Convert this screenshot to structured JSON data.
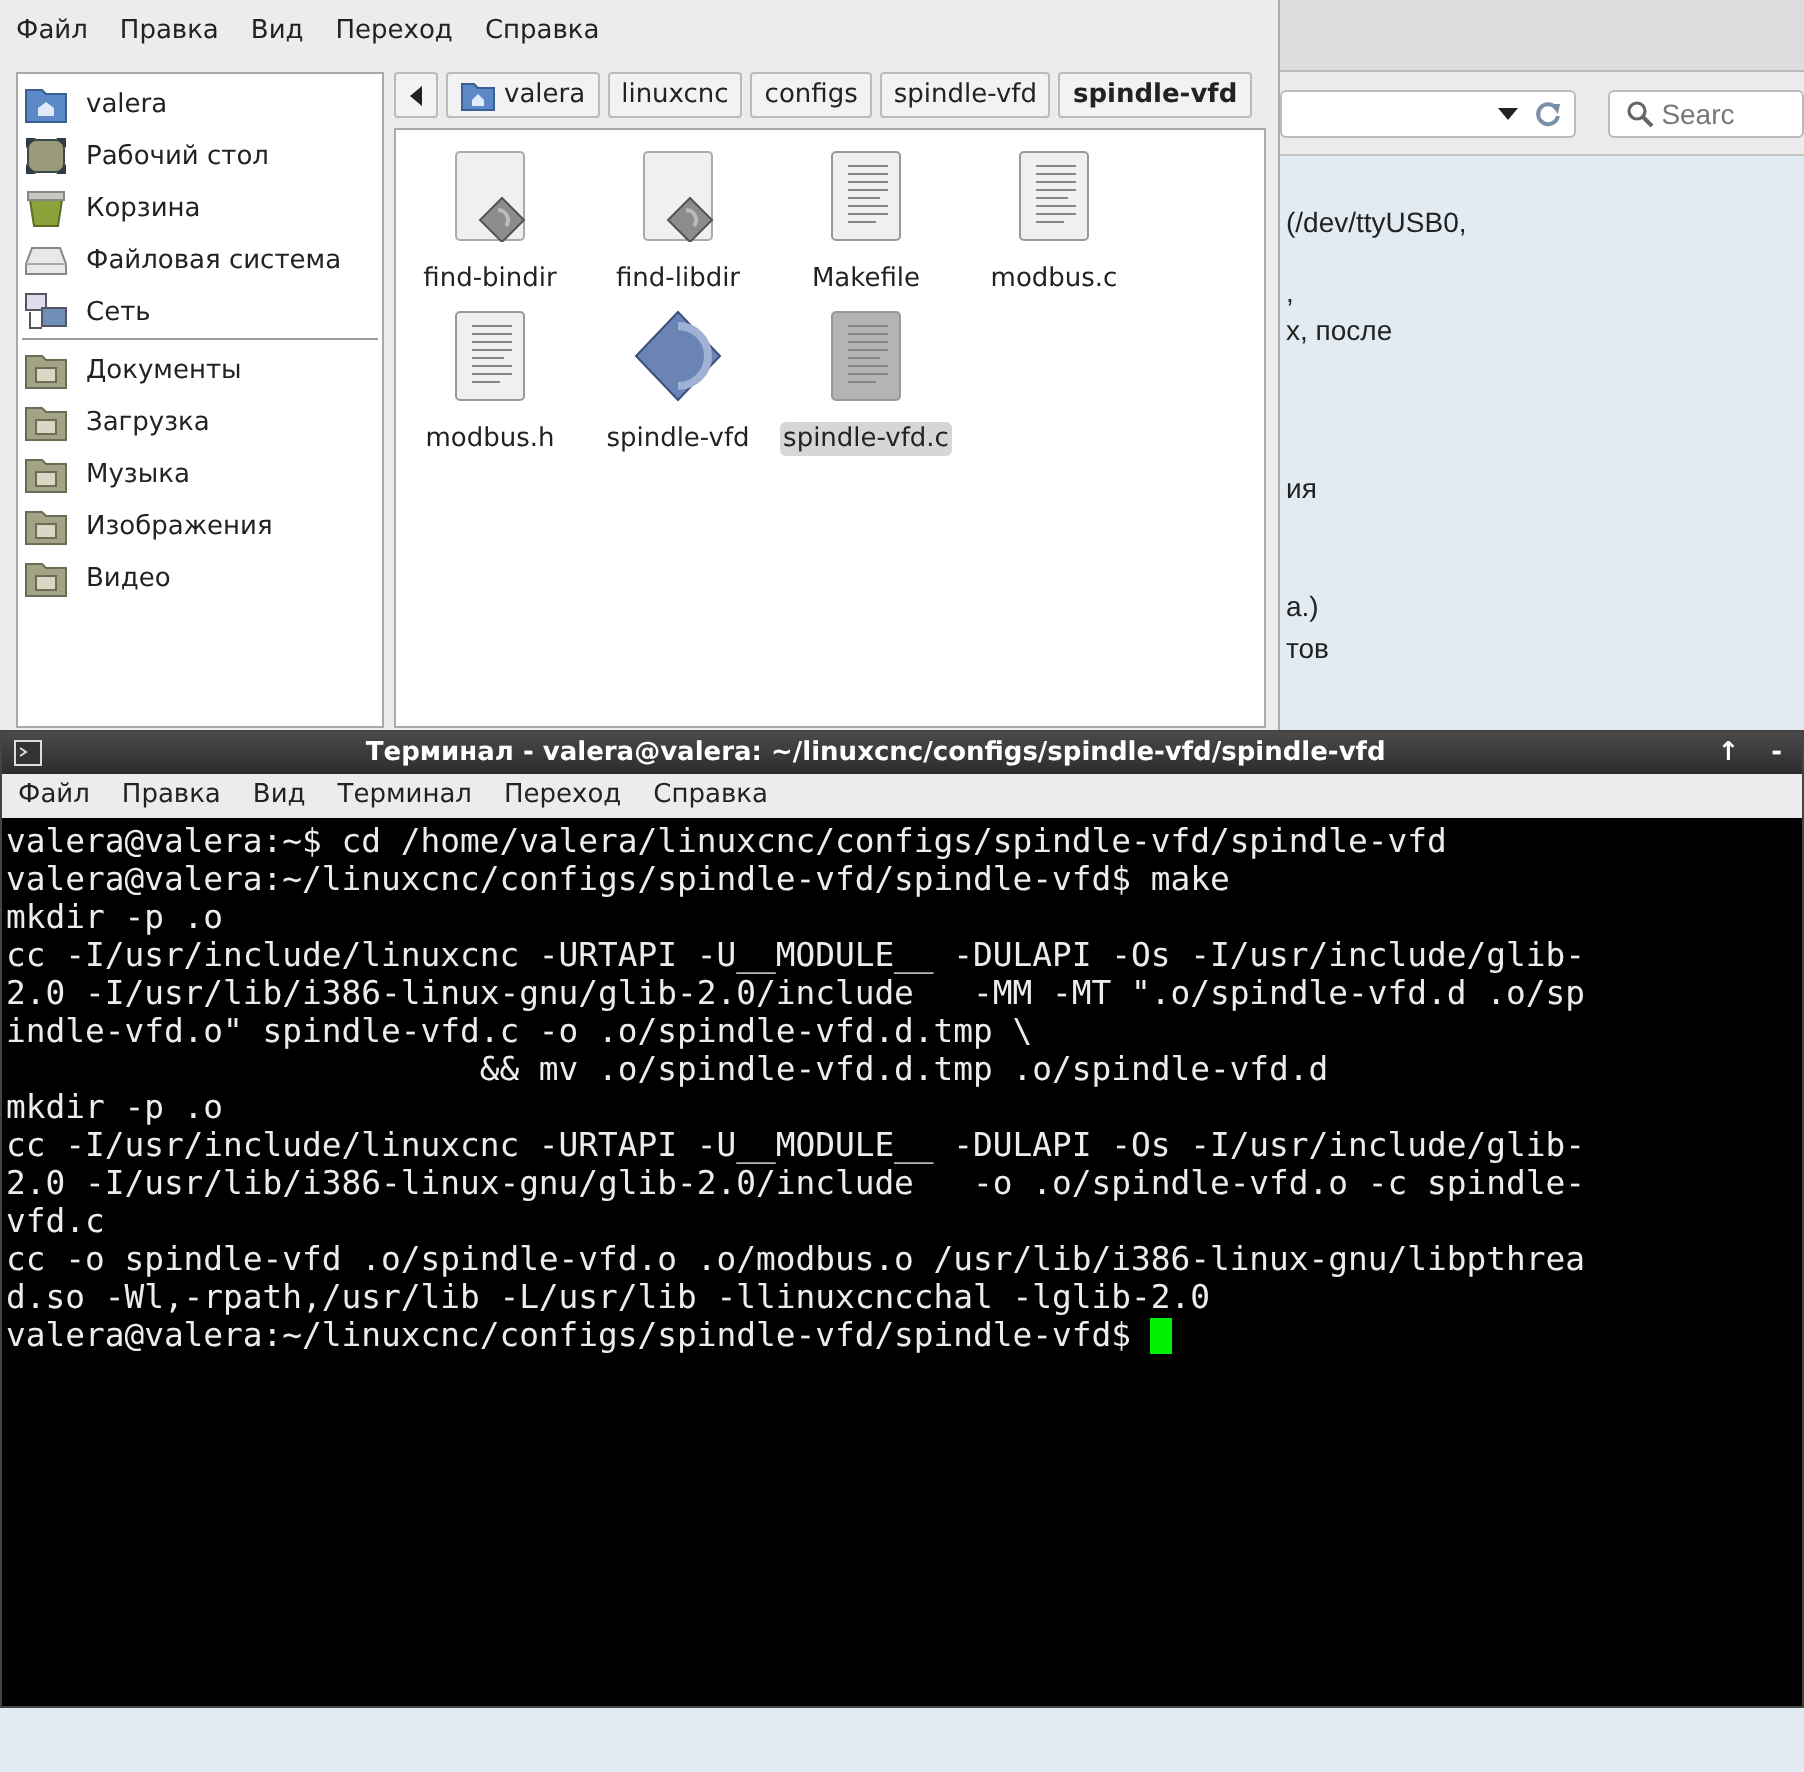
{
  "browser": {
    "search": {
      "placeholder": "Searc"
    },
    "page_fragments": [
      {
        "text": "(/dev/ttyUSB0,"
      },
      {
        "text": ","
      },
      {
        "text": "х, после"
      },
      {
        "text": "ия"
      },
      {
        "text": "а.)"
      },
      {
        "text": "тов"
      }
    ]
  },
  "file_manager": {
    "menu": [
      "Файл",
      "Правка",
      "Вид",
      "Переход",
      "Справка"
    ],
    "breadcrumbs": [
      {
        "label": "valera",
        "selected": false
      },
      {
        "label": "linuxcnc",
        "selected": false
      },
      {
        "label": "configs",
        "selected": false
      },
      {
        "label": "spindle-vfd",
        "selected": false
      },
      {
        "label": "spindle-vfd",
        "selected": true
      }
    ],
    "sidebar": {
      "places": [
        "valera",
        "Рабочий стол",
        "Корзина",
        "Файловая система",
        "Сеть"
      ],
      "bookmarks": [
        "Документы",
        "Загрузка",
        "Музыка",
        "Изображения",
        "Видео"
      ]
    },
    "files": [
      {
        "name": "find-bindir",
        "kind": "script",
        "selected": false
      },
      {
        "name": "find-libdir",
        "kind": "script",
        "selected": false
      },
      {
        "name": "Makefile",
        "kind": "text",
        "selected": false
      },
      {
        "name": "modbus.c",
        "kind": "text",
        "selected": false
      },
      {
        "name": "modbus.h",
        "kind": "text",
        "selected": false
      },
      {
        "name": "spindle-vfd",
        "kind": "executable",
        "selected": false
      },
      {
        "name": "spindle-vfd.c",
        "kind": "text",
        "selected": true
      }
    ]
  },
  "terminal": {
    "title": "Терминал - valera@valera: ~/linuxcnc/configs/spindle-vfd/spindle-vfd",
    "title_buttons": [
      "↑",
      "-"
    ],
    "menu": [
      "Файл",
      "Правка",
      "Вид",
      "Терминал",
      "Переход",
      "Справка"
    ],
    "lines": [
      "valera@valera:~$ cd /home/valera/linuxcnc/configs/spindle-vfd/spindle-vfd",
      "valera@valera:~/linuxcnc/configs/spindle-vfd/spindle-vfd$ make",
      "mkdir -p .o",
      "cc -I/usr/include/linuxcnc -URTAPI -U__MODULE__ -DULAPI -Os -I/usr/include/glib-",
      "2.0 -I/usr/lib/i386-linux-gnu/glib-2.0/include   -MM -MT \".o/spindle-vfd.d .o/sp",
      "indle-vfd.o\" spindle-vfd.c -o .o/spindle-vfd.d.tmp \\",
      "                        && mv .o/spindle-vfd.d.tmp .o/spindle-vfd.d",
      "mkdir -p .o",
      "cc -I/usr/include/linuxcnc -URTAPI -U__MODULE__ -DULAPI -Os -I/usr/include/glib-",
      "2.0 -I/usr/lib/i386-linux-gnu/glib-2.0/include   -o .o/spindle-vfd.o -c spindle-",
      "vfd.c",
      "cc -o spindle-vfd .o/spindle-vfd.o .o/modbus.o /usr/lib/i386-linux-gnu/libpthrea",
      "d.so -Wl,-rpath,/usr/lib -L/usr/lib -llinuxcncchal -lglib-2.0"
    ],
    "prompt": "valera@valera:~/linuxcnc/configs/spindle-vfd/spindle-vfd$ ",
    "cursor": true
  }
}
